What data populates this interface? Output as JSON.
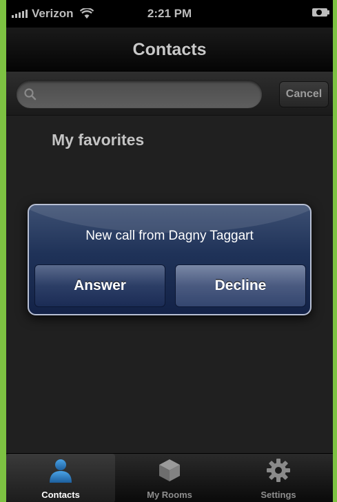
{
  "status_bar": {
    "carrier": "Verizon",
    "time": "2:21 PM"
  },
  "nav": {
    "title": "Contacts"
  },
  "search": {
    "placeholder": "",
    "value": "",
    "cancel_label": "Cancel"
  },
  "section": {
    "header": "My favorites"
  },
  "alert": {
    "message": "New call from Dagny Taggart",
    "answer_label": "Answer",
    "decline_label": "Decline"
  },
  "tab_bar": {
    "active": "Contacts",
    "tabs": [
      {
        "label": "Contacts",
        "icon": "contacts-icon"
      },
      {
        "label": "My Rooms",
        "icon": "cube-icon"
      },
      {
        "label": "Settings",
        "icon": "gear-icon"
      }
    ]
  },
  "colors": {
    "frame_border": "#7dc242",
    "alert_blue": "#1f3258",
    "contacts_icon_blue": "#2a7fc0"
  }
}
